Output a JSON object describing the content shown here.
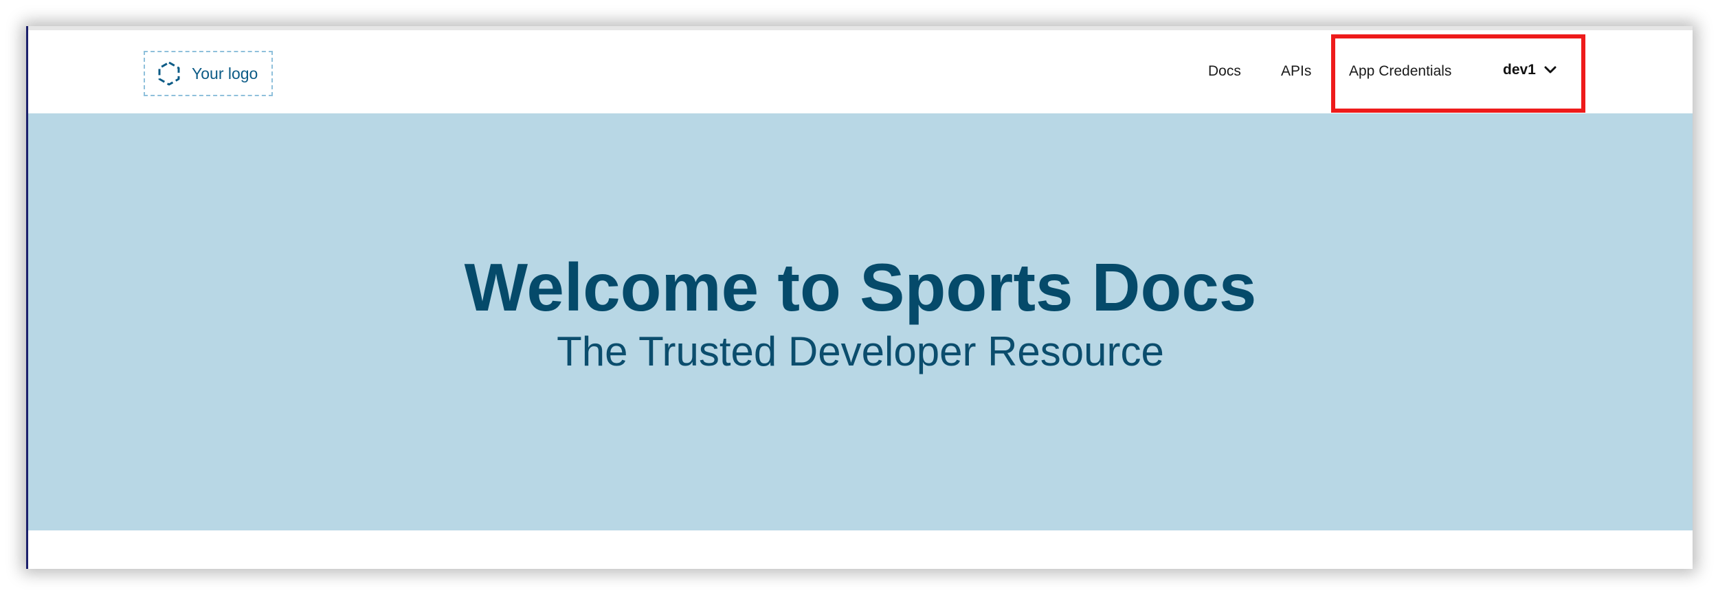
{
  "logo": {
    "text": "Your logo",
    "icon": "hexagon-dashed-icon"
  },
  "nav": {
    "items": [
      {
        "label": "Docs"
      },
      {
        "label": "APIs"
      },
      {
        "label": "App Credentials"
      }
    ],
    "user": {
      "label": "dev1",
      "icon": "chevron-down-icon"
    }
  },
  "hero": {
    "title": "Welcome to Sports Docs",
    "subtitle": "The Trusted Developer Resource"
  },
  "colors": {
    "hero_background": "#b8d7e5",
    "hero_text": "#054a6a",
    "highlight": "#ee1b1b",
    "logo_accent": "#0c5b86"
  }
}
